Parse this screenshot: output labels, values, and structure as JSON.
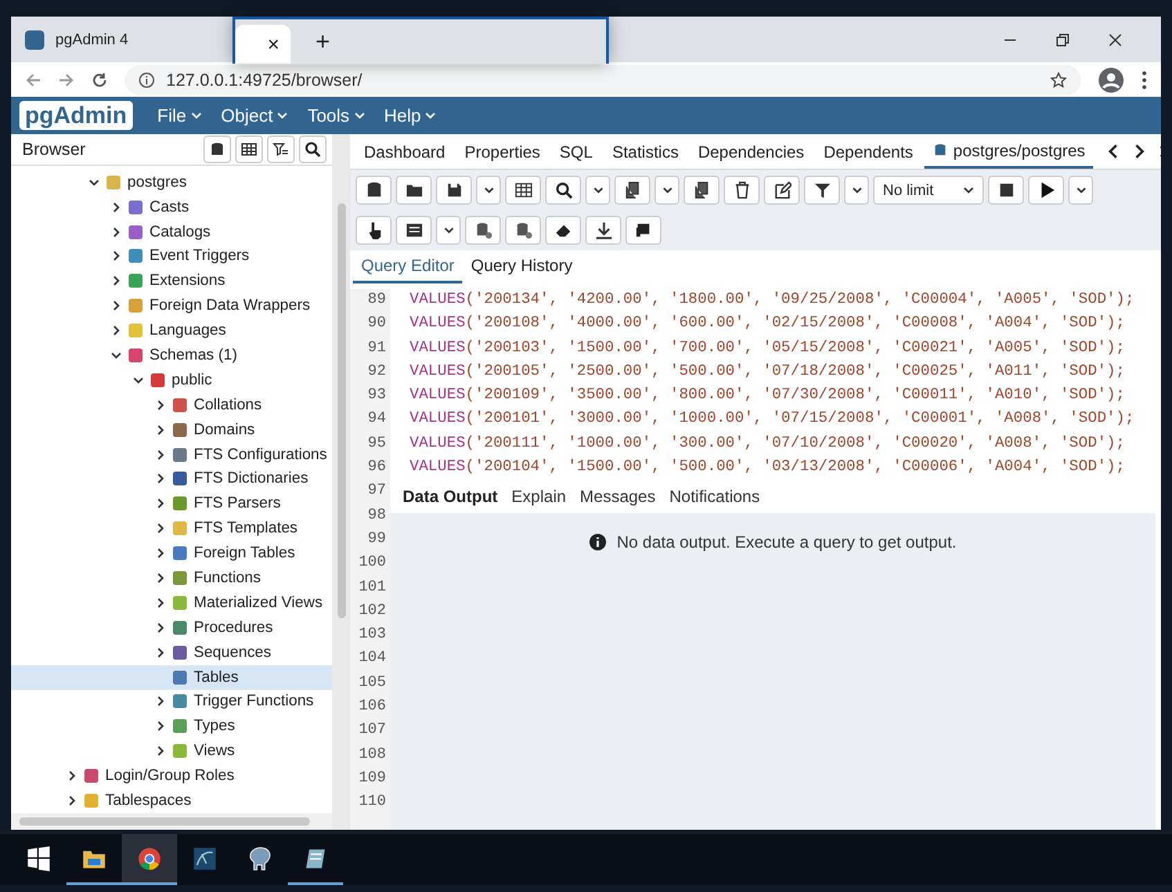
{
  "browser": {
    "tab_title": "pgAdmin 4",
    "url": "127.0.0.1:49725/browser/"
  },
  "popup": {
    "close_tab": "×",
    "new_tab": "+"
  },
  "menu": {
    "logo": "pgAdmin",
    "items": [
      "File",
      "Object",
      "Tools",
      "Help"
    ]
  },
  "browser_panel": {
    "title": "Browser"
  },
  "tree": [
    {
      "children": [
        {
          "label": "postgres",
          "expanded": true,
          "selected": false,
          "color": "#d9b44a",
          "children": [
            {
              "label": "Casts",
              "expanded": false,
              "selected": false,
              "color": "#7a6fd0"
            },
            {
              "label": "Catalogs",
              "expanded": false,
              "selected": false,
              "color": "#9a5fc8"
            },
            {
              "label": "Event Triggers",
              "expanded": false,
              "selected": false,
              "color": "#3d8fb8"
            },
            {
              "label": "Extensions",
              "expanded": false,
              "selected": false,
              "color": "#3aa35a"
            },
            {
              "label": "Foreign Data Wrappers",
              "expanded": false,
              "selected": false,
              "color": "#d9a03a"
            },
            {
              "label": "Languages",
              "expanded": false,
              "selected": false,
              "color": "#e2c23a"
            },
            {
              "label": "Schemas (1)",
              "expanded": true,
              "selected": false,
              "color": "#d6456a",
              "children": [
                {
                  "label": "public",
                  "expanded": true,
                  "selected": false,
                  "color": "#d43a3a",
                  "children": [
                    {
                      "label": "Collations",
                      "expanded": false,
                      "selected": false,
                      "color": "#d0504a"
                    },
                    {
                      "label": "Domains",
                      "expanded": false,
                      "selected": false,
                      "color": "#8a6a4a"
                    },
                    {
                      "label": "FTS Configurations",
                      "expanded": false,
                      "selected": false,
                      "color": "#6a7a8a"
                    },
                    {
                      "label": "FTS Dictionaries",
                      "expanded": false,
                      "selected": false,
                      "color": "#3a5aa0"
                    },
                    {
                      "label": "FTS Parsers",
                      "expanded": false,
                      "selected": false,
                      "color": "#6a9a2a"
                    },
                    {
                      "label": "FTS Templates",
                      "expanded": false,
                      "selected": false,
                      "color": "#e0b84a"
                    },
                    {
                      "label": "Foreign Tables",
                      "expanded": false,
                      "selected": false,
                      "color": "#4a7ac0"
                    },
                    {
                      "label": "Functions",
                      "expanded": false,
                      "selected": false,
                      "color": "#7a9a3a"
                    },
                    {
                      "label": "Materialized Views",
                      "expanded": false,
                      "selected": false,
                      "color": "#8ab83a"
                    },
                    {
                      "label": "Procedures",
                      "expanded": false,
                      "selected": false,
                      "color": "#4a8a6a"
                    },
                    {
                      "label": "Sequences",
                      "expanded": false,
                      "selected": false,
                      "color": "#6a5aa0"
                    },
                    {
                      "label": "Tables",
                      "selected": true,
                      "color": "#4a7ab0"
                    },
                    {
                      "label": "Trigger Functions",
                      "expanded": false,
                      "selected": false,
                      "color": "#4a8aa0"
                    },
                    {
                      "label": "Types",
                      "expanded": false,
                      "selected": false,
                      "color": "#5aa05a"
                    },
                    {
                      "label": "Views",
                      "expanded": false,
                      "selected": false,
                      "color": "#8ab83a"
                    }
                  ]
                }
              ]
            }
          ]
        }
      ]
    },
    {
      "label": "Login/Group Roles",
      "expanded": false,
      "selected": false,
      "color": "#c84a6a"
    },
    {
      "label": "Tablespaces",
      "expanded": false,
      "selected": false,
      "color": "#e0b030"
    }
  ],
  "tabs": [
    {
      "label": "Dashboard",
      "selected": false
    },
    {
      "label": "Properties",
      "selected": false
    },
    {
      "label": "SQL",
      "selected": false
    },
    {
      "label": "Statistics",
      "selected": false
    },
    {
      "label": "Dependencies",
      "selected": false
    },
    {
      "label": "Dependents",
      "selected": false
    },
    {
      "label": "postgres/postgres",
      "selected": true
    }
  ],
  "query_tool": {
    "limit": "No limit",
    "editor_tabs": [
      {
        "label": "Query Editor",
        "selected": true
      },
      {
        "label": "Query History",
        "selected": false
      }
    ],
    "line_numbers": [
      "89",
      "90",
      "91",
      "92",
      "93",
      "94",
      "95",
      "96",
      "97",
      "98",
      "99",
      "100",
      "101",
      "102",
      "103",
      "104",
      "105",
      "106",
      "107",
      "108",
      "109",
      "110"
    ],
    "code_lines": [
      {
        "keyword": "VALUES",
        "args": "('200134', '4200.00', '1800.00', '09/25/2008', 'C00004', 'A005', 'SOD');"
      },
      {
        "keyword": "VALUES",
        "args": "('200108', '4000.00', '600.00', '02/15/2008', 'C00008', 'A004', 'SOD');"
      },
      {
        "keyword": "VALUES",
        "args": "('200103', '1500.00', '700.00', '05/15/2008', 'C00021', 'A005', 'SOD');"
      },
      {
        "keyword": "VALUES",
        "args": "('200105', '2500.00', '500.00', '07/18/2008', 'C00025', 'A011', 'SOD');"
      },
      {
        "keyword": "VALUES",
        "args": "('200109', '3500.00', '800.00', '07/30/2008', 'C00011', 'A010', 'SOD');"
      },
      {
        "keyword": "VALUES",
        "args": "('200101', '3000.00', '1000.00', '07/15/2008', 'C00001', 'A008', 'SOD');"
      },
      {
        "keyword": "VALUES",
        "args": "('200111', '1000.00', '300.00', '07/10/2008', 'C00020', 'A008', 'SOD');"
      },
      {
        "keyword": "VALUES",
        "args": "('200104', '1500.00', '500.00', '03/13/2008', 'C00006', 'A004', 'SOD');"
      }
    ],
    "output_tabs": [
      {
        "label": "Data Output",
        "selected": true
      },
      {
        "label": "Explain",
        "selected": false
      },
      {
        "label": "Messages",
        "selected": false
      },
      {
        "label": "Notifications",
        "selected": false
      }
    ],
    "message": "No data output. Execute a query to get output."
  }
}
